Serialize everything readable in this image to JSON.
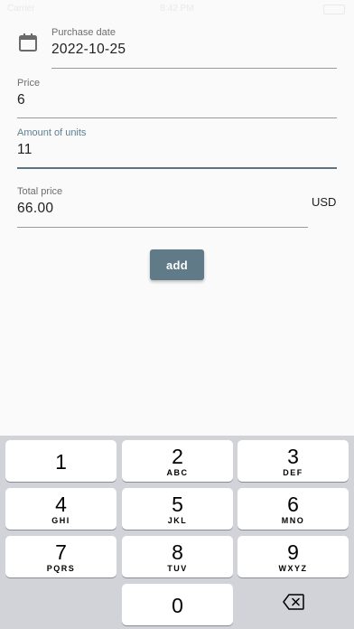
{
  "status_bar": {
    "carrier": "Carrier",
    "time": "8:42 PM"
  },
  "form": {
    "purchase_date": {
      "label": "Purchase date",
      "value": "2022-10-25"
    },
    "price": {
      "label": "Price",
      "value": "6"
    },
    "amount_of_units": {
      "label": "Amount of units",
      "value": "11"
    },
    "total_price": {
      "label": "Total price",
      "value": "66.00",
      "currency": "USD"
    },
    "add_label": "add"
  },
  "keypad": {
    "keys": [
      {
        "digit": "1",
        "letters": ""
      },
      {
        "digit": "2",
        "letters": "ABC"
      },
      {
        "digit": "3",
        "letters": "DEF"
      },
      {
        "digit": "4",
        "letters": "GHI"
      },
      {
        "digit": "5",
        "letters": "JKL"
      },
      {
        "digit": "6",
        "letters": "MNO"
      },
      {
        "digit": "7",
        "letters": "PQRS"
      },
      {
        "digit": "8",
        "letters": "TUV"
      },
      {
        "digit": "9",
        "letters": "WXYZ"
      },
      {
        "digit": "0",
        "letters": ""
      }
    ],
    "delete_icon": "backspace-icon"
  },
  "colors": {
    "accent": "#617a87",
    "focused_underline": "#5c7480",
    "keyboard_background": "#d1d3d9"
  }
}
